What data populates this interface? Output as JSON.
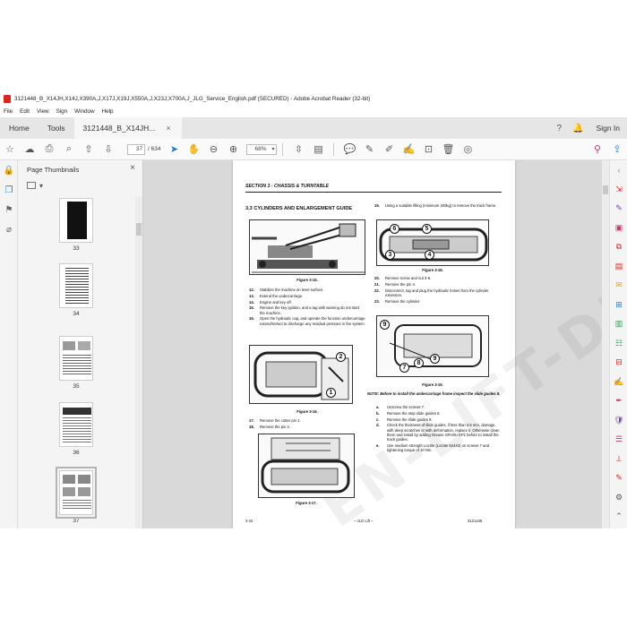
{
  "window": {
    "title": "3121448_B_X14JH,X14J,X390A,J,X17J,X19J,X550A,J,X23J,X700A,J_JLG_Service_English.pdf (SECURED) - Adobe Acrobat Reader (32-bit)"
  },
  "menu": [
    "File",
    "Edit",
    "View",
    "Sign",
    "Window",
    "Help"
  ],
  "tabs": {
    "home": "Home",
    "tools": "Tools",
    "doc": "3121448_B_X14JH...",
    "close": "×",
    "signin": "Sign In"
  },
  "toolbar": {
    "page_current": "37",
    "page_total": "/ 634",
    "zoom": "68%"
  },
  "thumbnails": {
    "title": "Page Thumbnails",
    "close": "×",
    "pages": [
      "33",
      "34",
      "35",
      "36",
      "37"
    ],
    "selected": "37"
  },
  "page": {
    "header": "SECTION 3 - CHASSIS & TURNTABLE",
    "section": "3.3     CYLINDERS AND ENLARGEMENT GUIDE",
    "fig15": "Figure 3-15.",
    "fig16": "Figure 3-16.",
    "fig17": "Figure 3-17.",
    "fig18": "Figure 3-18.",
    "fig19": "Figure 3-19.",
    "left_steps_a": [
      {
        "n": "12.",
        "t": "Stabilize the machine on level surface."
      },
      {
        "n": "13.",
        "t": "Extend the undercarriage."
      },
      {
        "n": "14.",
        "t": "Engine and key off."
      },
      {
        "n": "15.",
        "t": "Remove the key ignition, and a tag with warning do not start the machine."
      },
      {
        "n": "16.",
        "t": "Open the hydraulic cap, and operate the function undercarriage extend/retract to discharge any residual pressure in the system."
      }
    ],
    "left_steps_b": [
      {
        "n": "17.",
        "t": "Remove the cotter pin 1."
      },
      {
        "n": "18.",
        "t": "Remove the pin 2."
      }
    ],
    "right_steps_a": [
      {
        "n": "19.",
        "t": "Using a suitable lifting (minimum 200kg) to remove the track frame."
      }
    ],
    "right_steps_b": [
      {
        "n": "20.",
        "t": "Remove screw and nut 3-6."
      },
      {
        "n": "21.",
        "t": "Remove the pin 4."
      },
      {
        "n": "22.",
        "t": "Disconnect, tag and plug the hydraulic hoses from the cylinder extension."
      },
      {
        "n": "23.",
        "t": "Remove the cylinder."
      }
    ],
    "note": "NOTE: Before to install the undercarriage frame inspect the slide guides 8.",
    "right_steps_c": [
      {
        "n": "a.",
        "t": "Unscrew the screws 7."
      },
      {
        "n": "b.",
        "t": "Remove the stop slide guides 8."
      },
      {
        "n": "c.",
        "t": "Remove the slide guides 9."
      },
      {
        "n": "d.",
        "t": "Check the thickness of slide guides, if less than 3.5 mm, damage, with deep scratches or with deformation, replace it. Otherwise clean them and install by adding Grease GR-MU EP1 before to install the track guides."
      },
      {
        "n": "e.",
        "t": "Use medium strength Loctite (Loctite 52443) on screws 7 and tightening torque of 10 Nm."
      }
    ],
    "callouts_16": [
      "2",
      "1"
    ],
    "callouts_18": [
      "6",
      "5",
      "3",
      "4"
    ],
    "callouts_19": [
      "9",
      "7",
      "8",
      "9"
    ],
    "footer_left": "3-10",
    "footer_center": "– JLG Lift –",
    "footer_right": "3121448",
    "watermark": "EN-LIFT-DEPO.COM"
  },
  "colors": {
    "acrobat_red": "#d9261c",
    "accent_blue": "#1f7bd1"
  }
}
